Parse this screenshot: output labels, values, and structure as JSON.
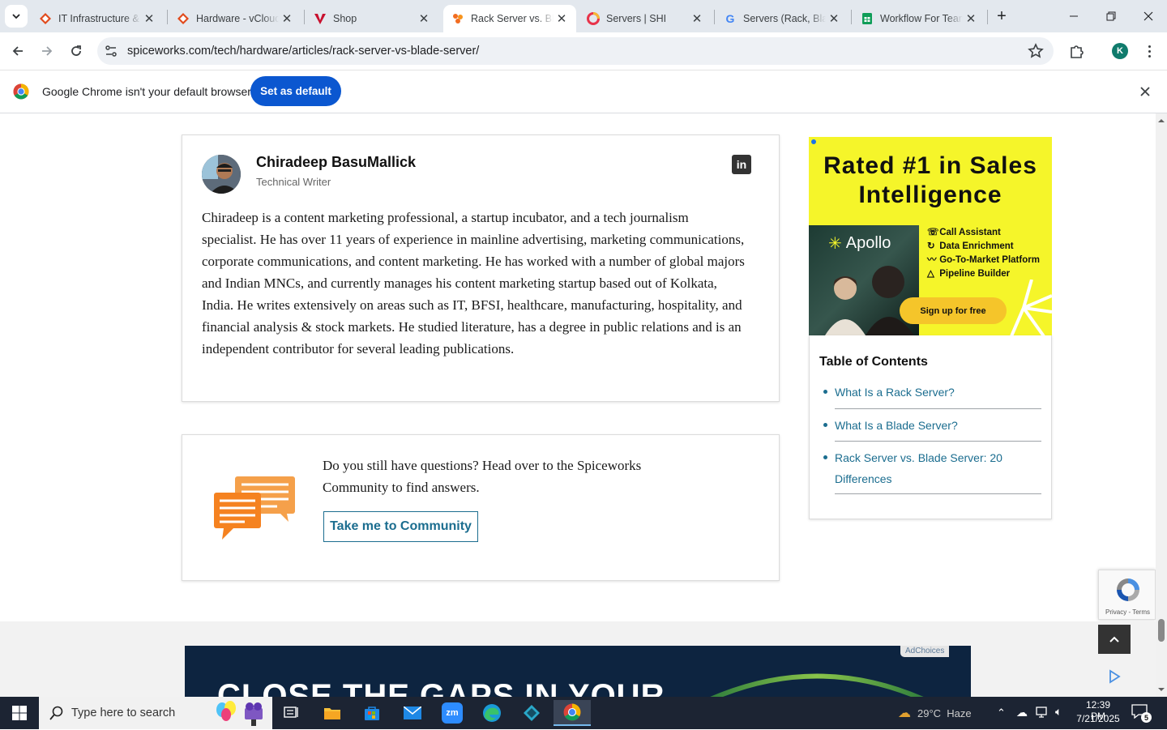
{
  "browser": {
    "tabs": [
      {
        "title": "IT Infrastructure & ...",
        "icon": "orange-diamond-icon",
        "active": false
      },
      {
        "title": "Hardware - vCloud ...",
        "icon": "orange-diamond-icon",
        "active": false
      },
      {
        "title": "Shop",
        "icon": "red-v-logo-icon",
        "active": false
      },
      {
        "title": "Rack Server vs. Bla...",
        "icon": "spiceworks-icon",
        "active": true
      },
      {
        "title": "Servers | SHI",
        "icon": "shi-logo-icon",
        "active": false
      },
      {
        "title": "Servers (Rack, Blac...",
        "icon": "google-icon",
        "active": false
      },
      {
        "title": "Workflow For Tean...",
        "icon": "sheets-icon",
        "active": false
      }
    ],
    "url": "spiceworks.com/tech/hardware/articles/rack-server-vs-blade-server/",
    "profile_initial": "K",
    "colors": {
      "tabstrip": "#e3e8ee",
      "profile": "#0f7b6c",
      "accent": "#0b57d0"
    }
  },
  "infobar": {
    "message": "Google Chrome isn't your default browser",
    "button": "Set as default"
  },
  "author": {
    "name": "Chiradeep BasuMallick",
    "role": "Technical Writer",
    "bio": "Chiradeep is a content marketing professional, a startup incubator, and a tech journalism specialist. He has over 11 years of experience in mainline advertising, marketing communications, corporate communications, and content marketing. He has worked with a number of global majors and Indian MNCs, and currently manages his content marketing startup based out of Kolkata, India. He writes extensively on areas such as IT, BFSI, healthcare, manufacturing, hospitality, and financial analysis & stock markets. He studied literature, has a degree in public relations and is an independent contributor for several leading publications.",
    "social_icon": "linkedin-icon"
  },
  "community": {
    "text": "Do you still have questions? Head over to the Spiceworks Community to find answers.",
    "button": "Take me to Community"
  },
  "ad": {
    "headline": "Rated #1 in Sales Intelligence",
    "brand": "Apollo",
    "features": [
      "Call Assistant",
      "Data Enrichment",
      "Go-To-Market Platform",
      "Pipeline Builder"
    ],
    "cta": "Sign up for free",
    "bg_color": "#f5f52a"
  },
  "toc": {
    "title": "Table of Contents",
    "items": [
      "What Is a Rack Server?",
      "What Is a Blade Server?",
      "Rack Server vs. Blade Server: 20 Differences"
    ]
  },
  "recaptcha": {
    "privacy": "Privacy",
    "sep": " - ",
    "terms": "Terms"
  },
  "bottom_ad": {
    "headline": "CLOSE THE GAPS IN YOUR",
    "adchoices": "AdChoices"
  },
  "taskbar": {
    "search_placeholder": "Type here to search",
    "weather": "29°C  Haze",
    "time": "12:39 PM",
    "date": "7/21/2025",
    "notification_count": "5"
  }
}
